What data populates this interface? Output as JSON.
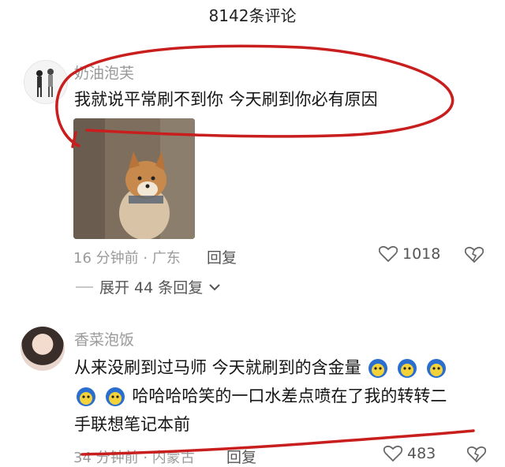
{
  "header": {
    "title": "8142条评论"
  },
  "comments": [
    {
      "username": "奶油泡芙",
      "text": "我就说平常刷不到你 今天刷到你必有原因",
      "meta": "16 分钟前 · 广东",
      "reply_label": "回复",
      "likes": "1018",
      "expand_label": "展开 44 条回复"
    },
    {
      "username": "香菜泡饭",
      "text_line1": "从来没刷到过马师 今天就刷到的含金量",
      "text_line2": "哈哈哈哈笑的一口水差点喷在了我的转转二",
      "text_line3": "手联想笔记本前",
      "meta": "34 分钟前 · 内蒙古",
      "reply_label": "回复",
      "likes": "483"
    }
  ],
  "colors": {
    "annotation": "#c81e1e",
    "text_muted": "#9a9a9a"
  },
  "icons": [
    "heart-icon",
    "dislike-heart-icon",
    "chevron-down-icon",
    "emoji-icon"
  ]
}
